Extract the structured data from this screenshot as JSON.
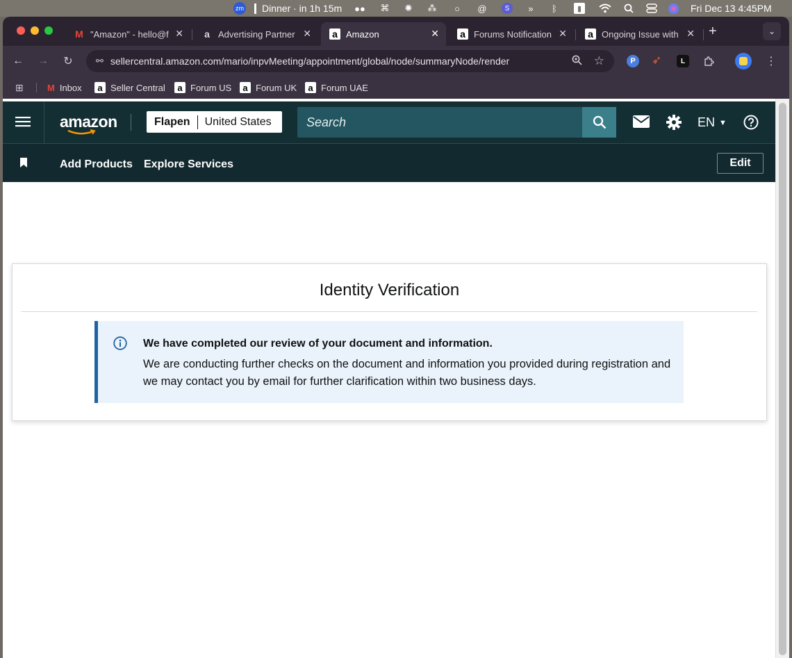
{
  "menubar": {
    "event": "Dinner · in 1h 15m",
    "datetime": "Fri Dec 13  4:45PM",
    "zoom_badge": "zm"
  },
  "tabs": [
    {
      "title": "\"Amazon\" - hello@f",
      "icon": "gmail-icon"
    },
    {
      "title": "Advertising Partner",
      "icon": "amazon-icon"
    },
    {
      "title": "Amazon",
      "icon": "amazon-icon",
      "active": true
    },
    {
      "title": "Forums Notification",
      "icon": "amazon-icon"
    },
    {
      "title": "Ongoing Issue with",
      "icon": "amazon-icon"
    }
  ],
  "toolbar": {
    "url": "sellercentral.amazon.com/mario/inpvMeeting/appointment/global/node/summaryNode/render"
  },
  "bookmarks": [
    {
      "label": "Inbox",
      "icon": "gmail-icon"
    },
    {
      "label": "Seller Central",
      "icon": "amazon-icon"
    },
    {
      "label": "Forum US",
      "icon": "amazon-icon"
    },
    {
      "label": "Forum UK",
      "icon": "amazon-icon"
    },
    {
      "label": "Forum UAE",
      "icon": "amazon-icon"
    }
  ],
  "header": {
    "logo": "amazon",
    "store_name": "Flapen",
    "marketplace": "United States",
    "search_placeholder": "Search",
    "language": "EN"
  },
  "subnav": {
    "add_products": "Add Products",
    "explore_services": "Explore Services",
    "edit": "Edit"
  },
  "content": {
    "title": "Identity Verification",
    "alert_heading": "We have completed our review of your document and information.",
    "alert_body": "We are conducting further checks on the document and information you provided during registration and we may contact you by email for further clarification within two business days."
  },
  "colors": {
    "nav_bg": "#132f34",
    "search_bg": "#235660",
    "search_button": "#3b7f8b",
    "alert_bg": "#eaf3fb",
    "alert_accent": "#2162a1"
  }
}
